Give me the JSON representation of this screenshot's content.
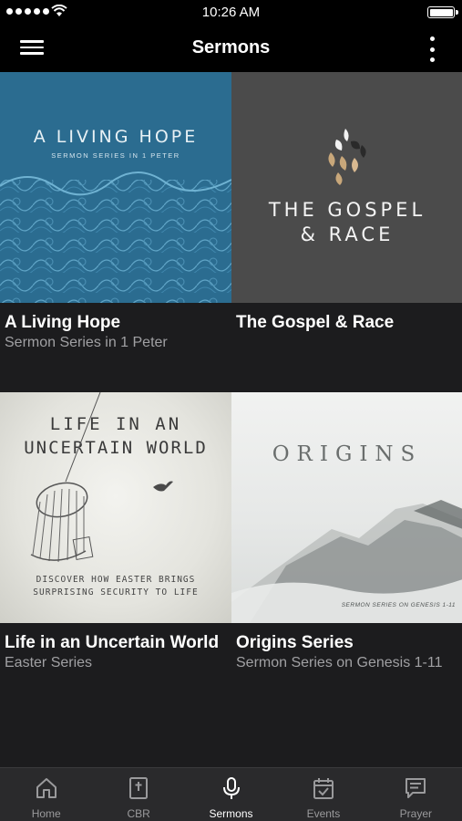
{
  "status_bar": {
    "time": "10:26 AM",
    "signal_bars": 5,
    "battery_level": 1.0
  },
  "nav": {
    "title": "Sermons",
    "menu_icon": "hamburger-menu-icon",
    "more_icon": "more-vertical-icon"
  },
  "series": [
    {
      "title": "A Living Hope",
      "subtitle": "Sermon Series in 1 Peter",
      "art_heading": "A LIVING HOPE",
      "art_sub": "SERMON SERIES IN 1 PETER"
    },
    {
      "title": "The Gospel & Race",
      "subtitle": "",
      "art_line1": "THE GOSPEL",
      "art_line2": "& RACE"
    },
    {
      "title": "Life in an Uncertain World",
      "subtitle": "Easter Series",
      "art_line1": "LIFE IN AN",
      "art_line2": "UNCERTAIN WORLD",
      "art_bottom1": "DISCOVER HOW EASTER BRINGS",
      "art_bottom2": "SURPRISING SECURITY TO LIFE"
    },
    {
      "title": "Origins Series",
      "subtitle": "Sermon Series on Genesis 1-11",
      "art_heading": "ORIGINS",
      "art_sub": "SERMON SERIES ON GENESIS 1-11"
    }
  ],
  "tabs": [
    {
      "label": "Home",
      "icon": "home-icon",
      "active": false
    },
    {
      "label": "CBR",
      "icon": "bible-icon",
      "active": false
    },
    {
      "label": "Sermons",
      "icon": "microphone-icon",
      "active": true
    },
    {
      "label": "Events",
      "icon": "calendar-check-icon",
      "active": false
    },
    {
      "label": "Prayer",
      "icon": "message-icon",
      "active": false
    }
  ],
  "colors": {
    "background": "#1c1c1e",
    "bar": "#000000",
    "tab_bar": "#2a2a2c",
    "living_hope_blue": "#2a6b8f",
    "gospel_gray": "#4a4a4a"
  }
}
